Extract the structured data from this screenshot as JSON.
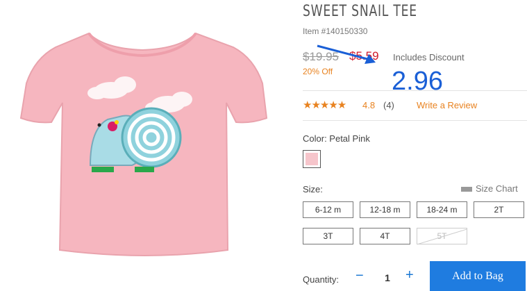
{
  "product": {
    "title": "SWEET SNAIL TEE",
    "item_number": "Item #140150330",
    "original_price": "$19.95",
    "sale_price": "$5.59",
    "discount_note": "Includes Discount",
    "percent_off": "20% Off"
  },
  "annotation": {
    "text": "2.96",
    "color": "#1a5fd6"
  },
  "reviews": {
    "stars": "★★★★★",
    "rating": "4.8",
    "count": "(4)",
    "write_review": "Write a Review"
  },
  "color": {
    "label": "Color: Petal Pink",
    "swatch_hex": "#f6c5cb"
  },
  "size": {
    "label": "Size:",
    "chart_link": "Size Chart",
    "options": [
      "6-12 m",
      "12-18 m",
      "18-24 m",
      "2T",
      "3T",
      "4T",
      "5T"
    ],
    "unavailable": [
      "5T"
    ]
  },
  "quantity": {
    "label": "Quantity:",
    "minus": "−",
    "value": "1",
    "plus": "+"
  },
  "cart": {
    "add_label": "Add to Bag"
  },
  "colors": {
    "accent": "#e8821f",
    "sale": "#d0192b",
    "button": "#1f7ce0"
  }
}
